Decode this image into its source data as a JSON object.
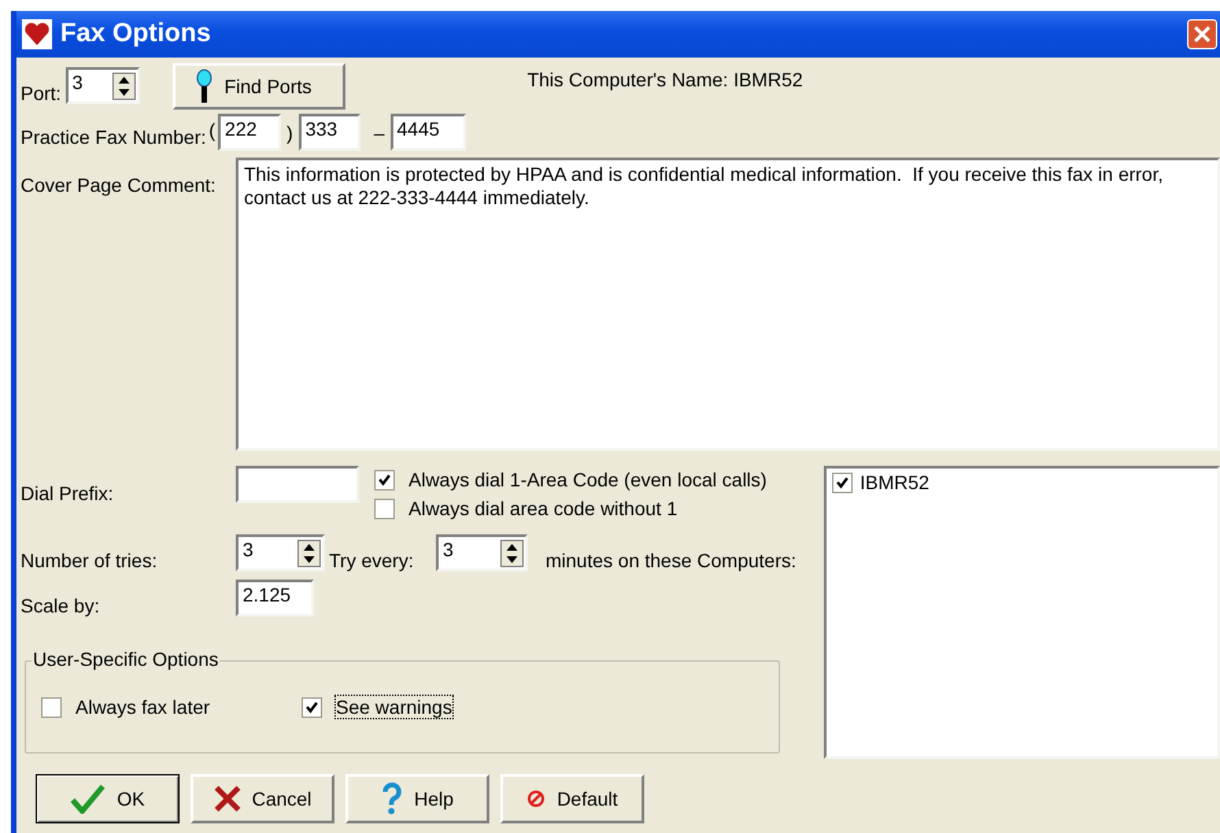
{
  "window": {
    "title": "Fax Options"
  },
  "port": {
    "label": "Port:",
    "value": "3"
  },
  "find_ports_button": "Find Ports",
  "computer_name": "This Computer's Name: IBMR52",
  "fax_number": {
    "label": "Practice Fax Number:",
    "open_paren": "(",
    "area_code": "222",
    "close_paren": ")",
    "prefix": "333",
    "dash": "–",
    "line": "4445"
  },
  "cover_page_comment": {
    "label": "Cover Page Comment:",
    "value": "This information is protected by HPAA and is confidential medical information.  If you receive this fax in error, contact us at 222-333-4444 immediately."
  },
  "dial_prefix": {
    "label": "Dial Prefix:"
  },
  "dial_options": [
    {
      "label": "Always dial 1-Area Code (even local calls)",
      "checked": true
    },
    {
      "label": "Always dial area code without 1",
      "checked": false
    }
  ],
  "tries": {
    "label": "Number of tries:",
    "value": "3",
    "try_every_label": "Try every:",
    "interval": "3",
    "minutes_label": "minutes on these Computers:"
  },
  "scale": {
    "label": "Scale by:",
    "value": "2.125"
  },
  "computers": [
    {
      "name": "IBMR52",
      "checked": true
    }
  ],
  "user_options": {
    "title": "User-Specific Options",
    "items": [
      {
        "label": "Always fax later",
        "checked": false,
        "focused": false
      },
      {
        "label": "See warnings",
        "checked": true,
        "focused": true
      }
    ]
  },
  "buttons": [
    {
      "label": "OK",
      "kind": "ok"
    },
    {
      "label": "Cancel",
      "kind": "cancel"
    },
    {
      "label": "Help",
      "kind": "help"
    },
    {
      "label": "Default",
      "kind": "default"
    }
  ]
}
